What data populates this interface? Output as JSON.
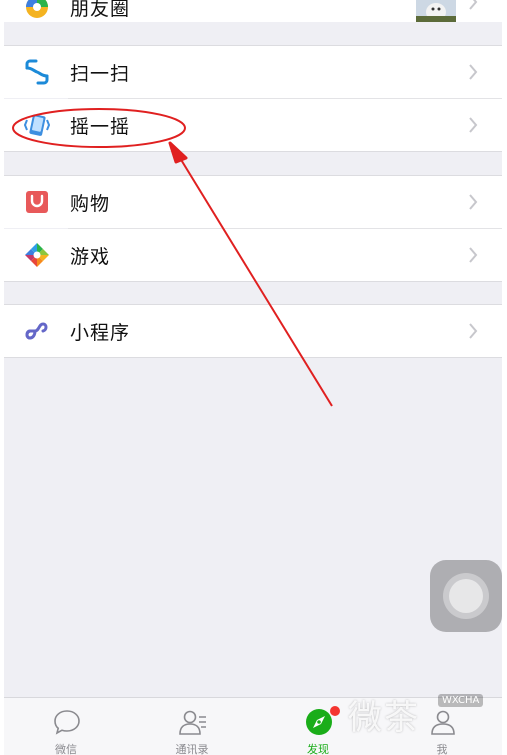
{
  "menu": {
    "moments": {
      "label": "朋友圈"
    },
    "scan": {
      "label": "扫一扫"
    },
    "shake": {
      "label": "摇一摇"
    },
    "shopping": {
      "label": "购物"
    },
    "games": {
      "label": "游戏"
    },
    "mini_programs": {
      "label": "小程序"
    }
  },
  "tabbar": {
    "chats": "微信",
    "contacts": "通讯录",
    "discover": "发现",
    "me": "我"
  },
  "watermark": {
    "text": "微茶",
    "badge": "WXCHA"
  },
  "colors": {
    "background": "#efeff4",
    "active_tab": "#1aad19",
    "annotation": "#e02020",
    "scan_icon": "#1c8ad8",
    "shopping_icon": "#e8595a",
    "mini_program_icon": "#6467c8"
  },
  "icons": {
    "moments": "moments-icon",
    "scan": "scan-icon",
    "shake": "shake-icon",
    "shopping": "shopping-bag-icon",
    "games": "game-icon",
    "mini_programs": "mini-program-icon",
    "chevron": "chevron-right-icon"
  }
}
